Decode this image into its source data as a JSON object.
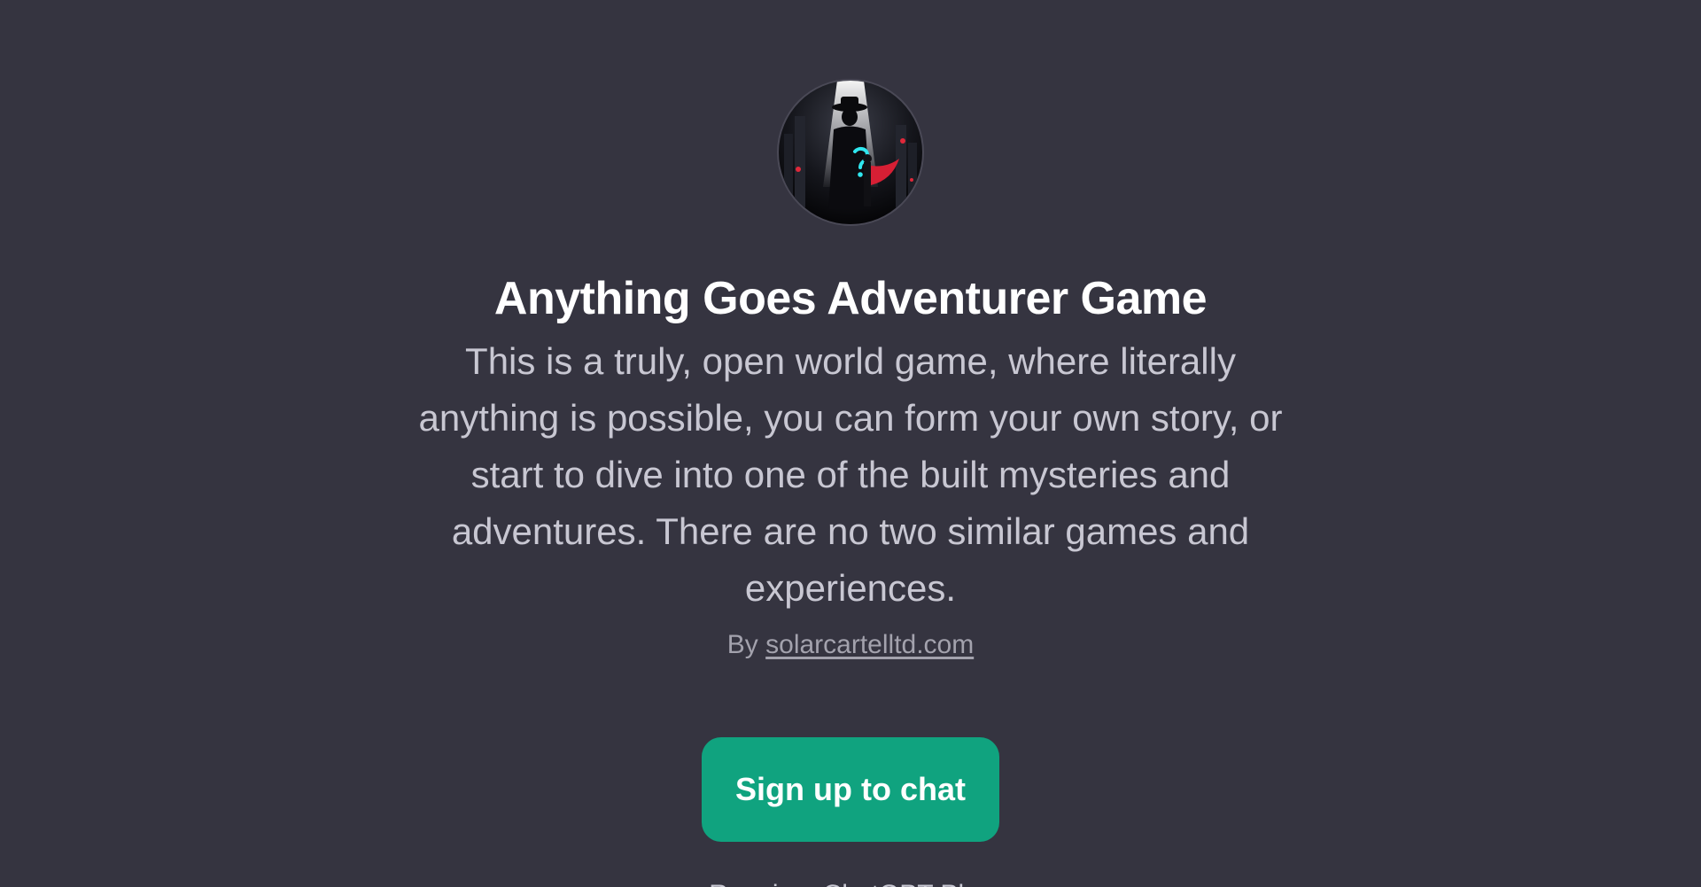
{
  "gpt": {
    "avatar_alt": "Anything Goes Adventurer Game avatar",
    "title": "Anything Goes Adventurer Game",
    "description": "This is a truly, open world game, where literally anything is possible, you can form your own story, or start to dive into one of the built mysteries and adventures. There are no two similar games and experiences.",
    "by_prefix": "By",
    "author": "solarcartelltd.com"
  },
  "cta": {
    "signup_label": "Sign up to chat"
  },
  "footer": {
    "cutoff_text": "Requires ChatGPT Plus"
  },
  "colors": {
    "background": "#353440",
    "accent": "#10a37f",
    "title": "#ffffff",
    "text": "#c8c7d2",
    "muted": "#a3a2ad"
  }
}
